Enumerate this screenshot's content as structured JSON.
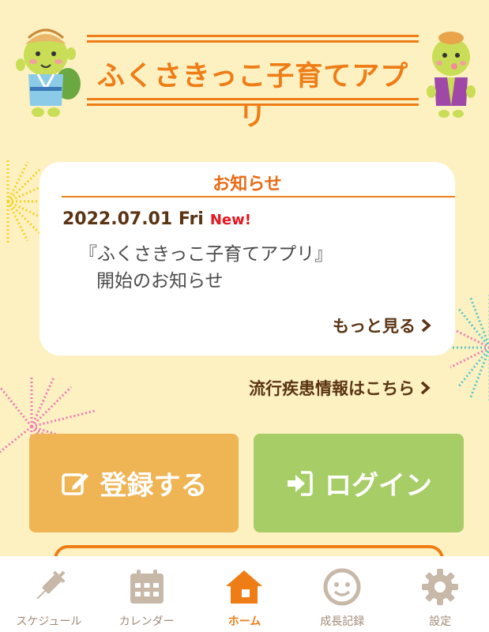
{
  "header": {
    "app_title": "ふくさきっこ子育てアプリ"
  },
  "notice": {
    "heading": "お知らせ",
    "date": "2022.07.01 Fri",
    "badge": "New!",
    "body_line1": "『ふくさきっこ子育てアプリ』",
    "body_line2": "開始のお知らせ",
    "more_label": "もっと見る"
  },
  "links": {
    "epidemic": "流行疾患情報はこちら"
  },
  "actions": {
    "register_label": "登録する",
    "login_label": "ログイン"
  },
  "nav": {
    "items": [
      {
        "label": "スケジュール",
        "icon": "syringe-icon"
      },
      {
        "label": "カレンダー",
        "icon": "calendar-icon"
      },
      {
        "label": "ホーム",
        "icon": "home-icon"
      },
      {
        "label": "成長記録",
        "icon": "smiley-face-icon"
      },
      {
        "label": "設定",
        "icon": "gear-icon"
      }
    ],
    "active_index": 2
  },
  "colors": {
    "background": "#fdf1c2",
    "accent_orange": "#ef7d16",
    "register_button": "#efb454",
    "login_button": "#a7cd66",
    "new_badge": "#e8141e",
    "nav_inactive": "#c8b8a8"
  }
}
